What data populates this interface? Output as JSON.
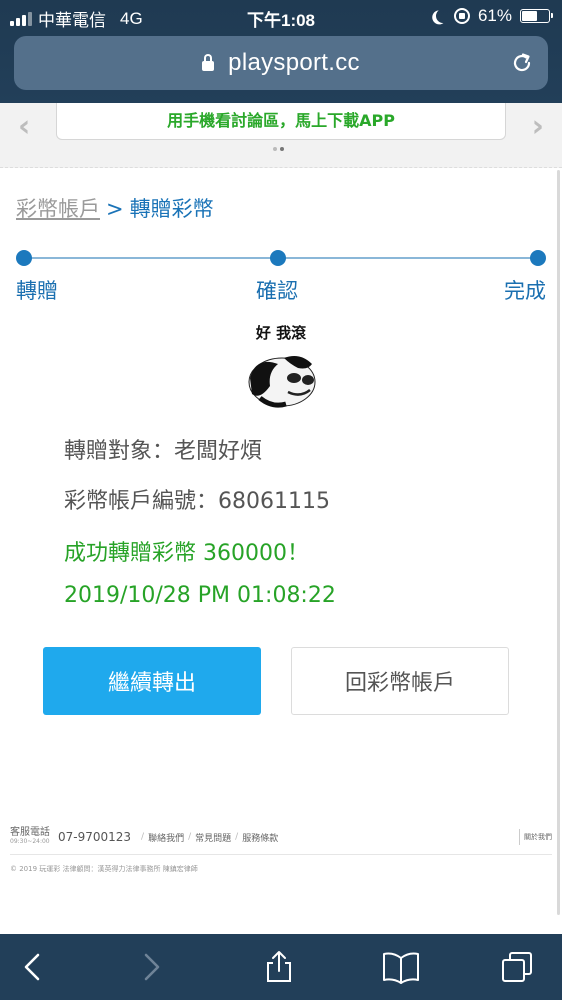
{
  "status_bar": {
    "carrier": "中華電信",
    "network": "4G",
    "time": "下午1:08",
    "battery_pct": "61%",
    "battery_level": 0.61
  },
  "browser": {
    "url": "playsport.cc"
  },
  "banner": {
    "text": "用手機看討論區，馬上下載APP"
  },
  "breadcrumb": {
    "home": "彩幣帳戶",
    "separator": ">",
    "current": "轉贈彩幣"
  },
  "steps": [
    {
      "label": "轉贈"
    },
    {
      "label": "確認"
    },
    {
      "label": "完成"
    }
  ],
  "meme": {
    "caption": "好 我滾"
  },
  "info": {
    "recipient": "轉贈對象：老闆好煩",
    "account_no": "彩幣帳戶編號：68061115",
    "success": "成功轉贈彩幣 360000！",
    "timestamp": "2019/10/28 PM 01:08:22"
  },
  "buttons": {
    "continue": "繼續轉出",
    "back": "回彩幣帳戶"
  },
  "footer": {
    "cs_label": "客服電話",
    "cs_hours": "09:30~24:00",
    "phone": "07-9700123",
    "links": [
      "聯絡我們",
      "常見問題",
      "服務條款"
    ],
    "about": "關於我們",
    "copyright": "© 2019 玩運彩 法律顧問：漢英得力法律事務所 陳鎮宏律師"
  },
  "colors": {
    "accent_blue": "#1fa9ed",
    "step_blue": "#1c79bd",
    "success_green": "#27a327",
    "chrome_navy": "#223f59"
  },
  "icons": [
    "signal-icon",
    "moon-icon",
    "orientation-lock-icon",
    "battery-icon",
    "lock-icon",
    "reload-icon",
    "back-icon",
    "forward-icon",
    "share-icon",
    "bookmarks-icon",
    "tabs-icon"
  ]
}
